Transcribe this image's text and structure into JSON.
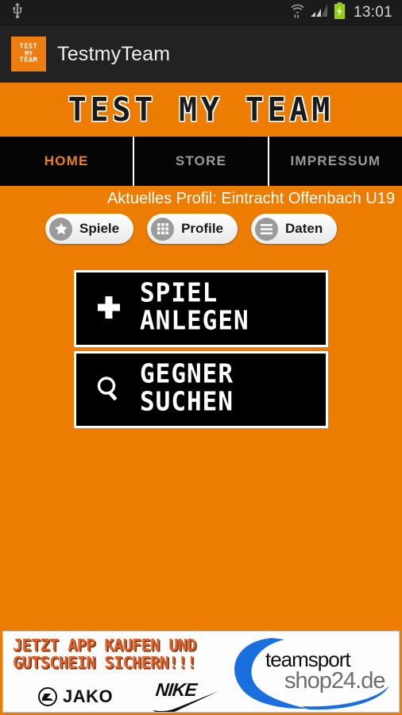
{
  "statusbar": {
    "usb_icon": "usb-icon",
    "wifi_icon": "wifi-icon",
    "signal_icon": "cellular-signal-icon",
    "battery_icon": "battery-charging-icon",
    "time": "13:01"
  },
  "actionbar": {
    "logo_line1": "Test",
    "logo_line2": "my",
    "logo_line3": "Team",
    "title": "TestmyTeam"
  },
  "banner": {
    "title": "Test my Team"
  },
  "nav": {
    "tabs": [
      {
        "label": "HOME",
        "active": true
      },
      {
        "label": "STORE",
        "active": false
      },
      {
        "label": "IMPRESSUM",
        "active": false
      }
    ]
  },
  "profile": {
    "line": "Aktuelles Profil: Eintracht Offenbach U19"
  },
  "pills": [
    {
      "label": "Spiele",
      "icon": "star-icon"
    },
    {
      "label": "Profile",
      "icon": "grid-icon"
    },
    {
      "label": "Daten",
      "icon": "list-icon"
    }
  ],
  "actions": [
    {
      "icon": "plus-icon",
      "line1": "Spiel",
      "line2": "anlegen"
    },
    {
      "icon": "search-icon",
      "line1": "Gegner",
      "line2": "suchen"
    }
  ],
  "ad": {
    "headline_line1": "Jetzt App kaufen und",
    "headline_line2": "Gutschein sichern!!!",
    "brand_jako": "JAKO",
    "brand_nike": "NIKE",
    "shop_word1": "teamsport",
    "shop_word2": "shop24.de"
  },
  "colors": {
    "orange": "#ec7d02",
    "accent_tab": "#e8821f",
    "black": "#000000",
    "ad_orange": "#e2622a",
    "shop_blue": "#1a6fe0"
  }
}
